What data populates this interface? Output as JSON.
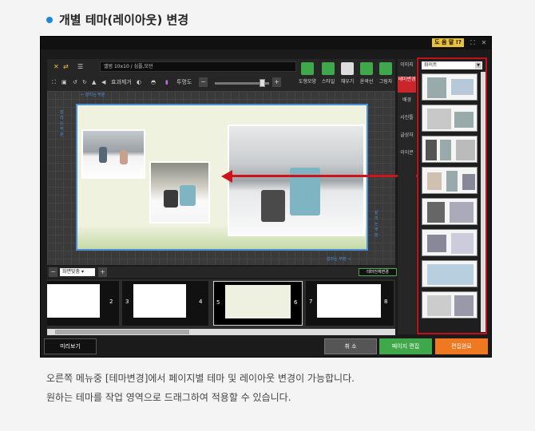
{
  "heading": {
    "title": "개별 테마(레이아웃) 변경"
  },
  "app": {
    "help_label": "도 움 말 !?",
    "book_title": "앨범 10x10 / 심플,모던",
    "toolbar2": {
      "effect_label": "효과제거",
      "opacity_label": "투명도"
    },
    "tools": [
      {
        "label": "도형모양",
        "color": "#3ea84a"
      },
      {
        "label": "스타일",
        "color": "#3ea84a"
      },
      {
        "label": "채우기",
        "color": "#dddddd"
      },
      {
        "label": "윤곽선",
        "color": "#3ea84a"
      },
      {
        "label": "그림자",
        "color": "#3ea84a"
      }
    ],
    "canvas": {
      "guide_top": "← 잘리는 부분",
      "guide_bottom": "잘리는 부분 →",
      "guide_left": "잘리는 부분",
      "guide_right": "잘리는 부분"
    },
    "sidebar_tabs": [
      {
        "label": "이미지",
        "active": false
      },
      {
        "label": "테마변경",
        "active": true
      },
      {
        "label": "배경",
        "active": false
      },
      {
        "label": "사진틀",
        "active": false
      },
      {
        "label": "글상자",
        "active": false
      },
      {
        "label": "이이콘",
        "active": false
      }
    ],
    "theme_panel": {
      "selected": "화이트"
    },
    "bottom": {
      "fit_label": "화면맞춤",
      "apply_all": "테마전체변경"
    },
    "pages": [
      {
        "left": "",
        "right": "2"
      },
      {
        "left": "3",
        "right": "4"
      },
      {
        "left": "5",
        "right": "6"
      },
      {
        "left": "7",
        "right": "8"
      }
    ],
    "buttons": {
      "preview": "미리보기",
      "cancel": "취 소",
      "edit_page": "페이지 편집",
      "finish": "편집완료"
    }
  },
  "description": {
    "line1": "오른쪽 메뉴중 [테마변경]에서 페이지별 테마 및 레이아웃 변경이 가능합니다.",
    "line2": "원하는 테마를 작업 영역으로 드래그하여 적용할 수 있습니다."
  },
  "colors": {
    "accent_blue": "#1e88d8",
    "panel_red": "#c1121b",
    "green": "#3ea84a",
    "orange": "#f07820"
  }
}
